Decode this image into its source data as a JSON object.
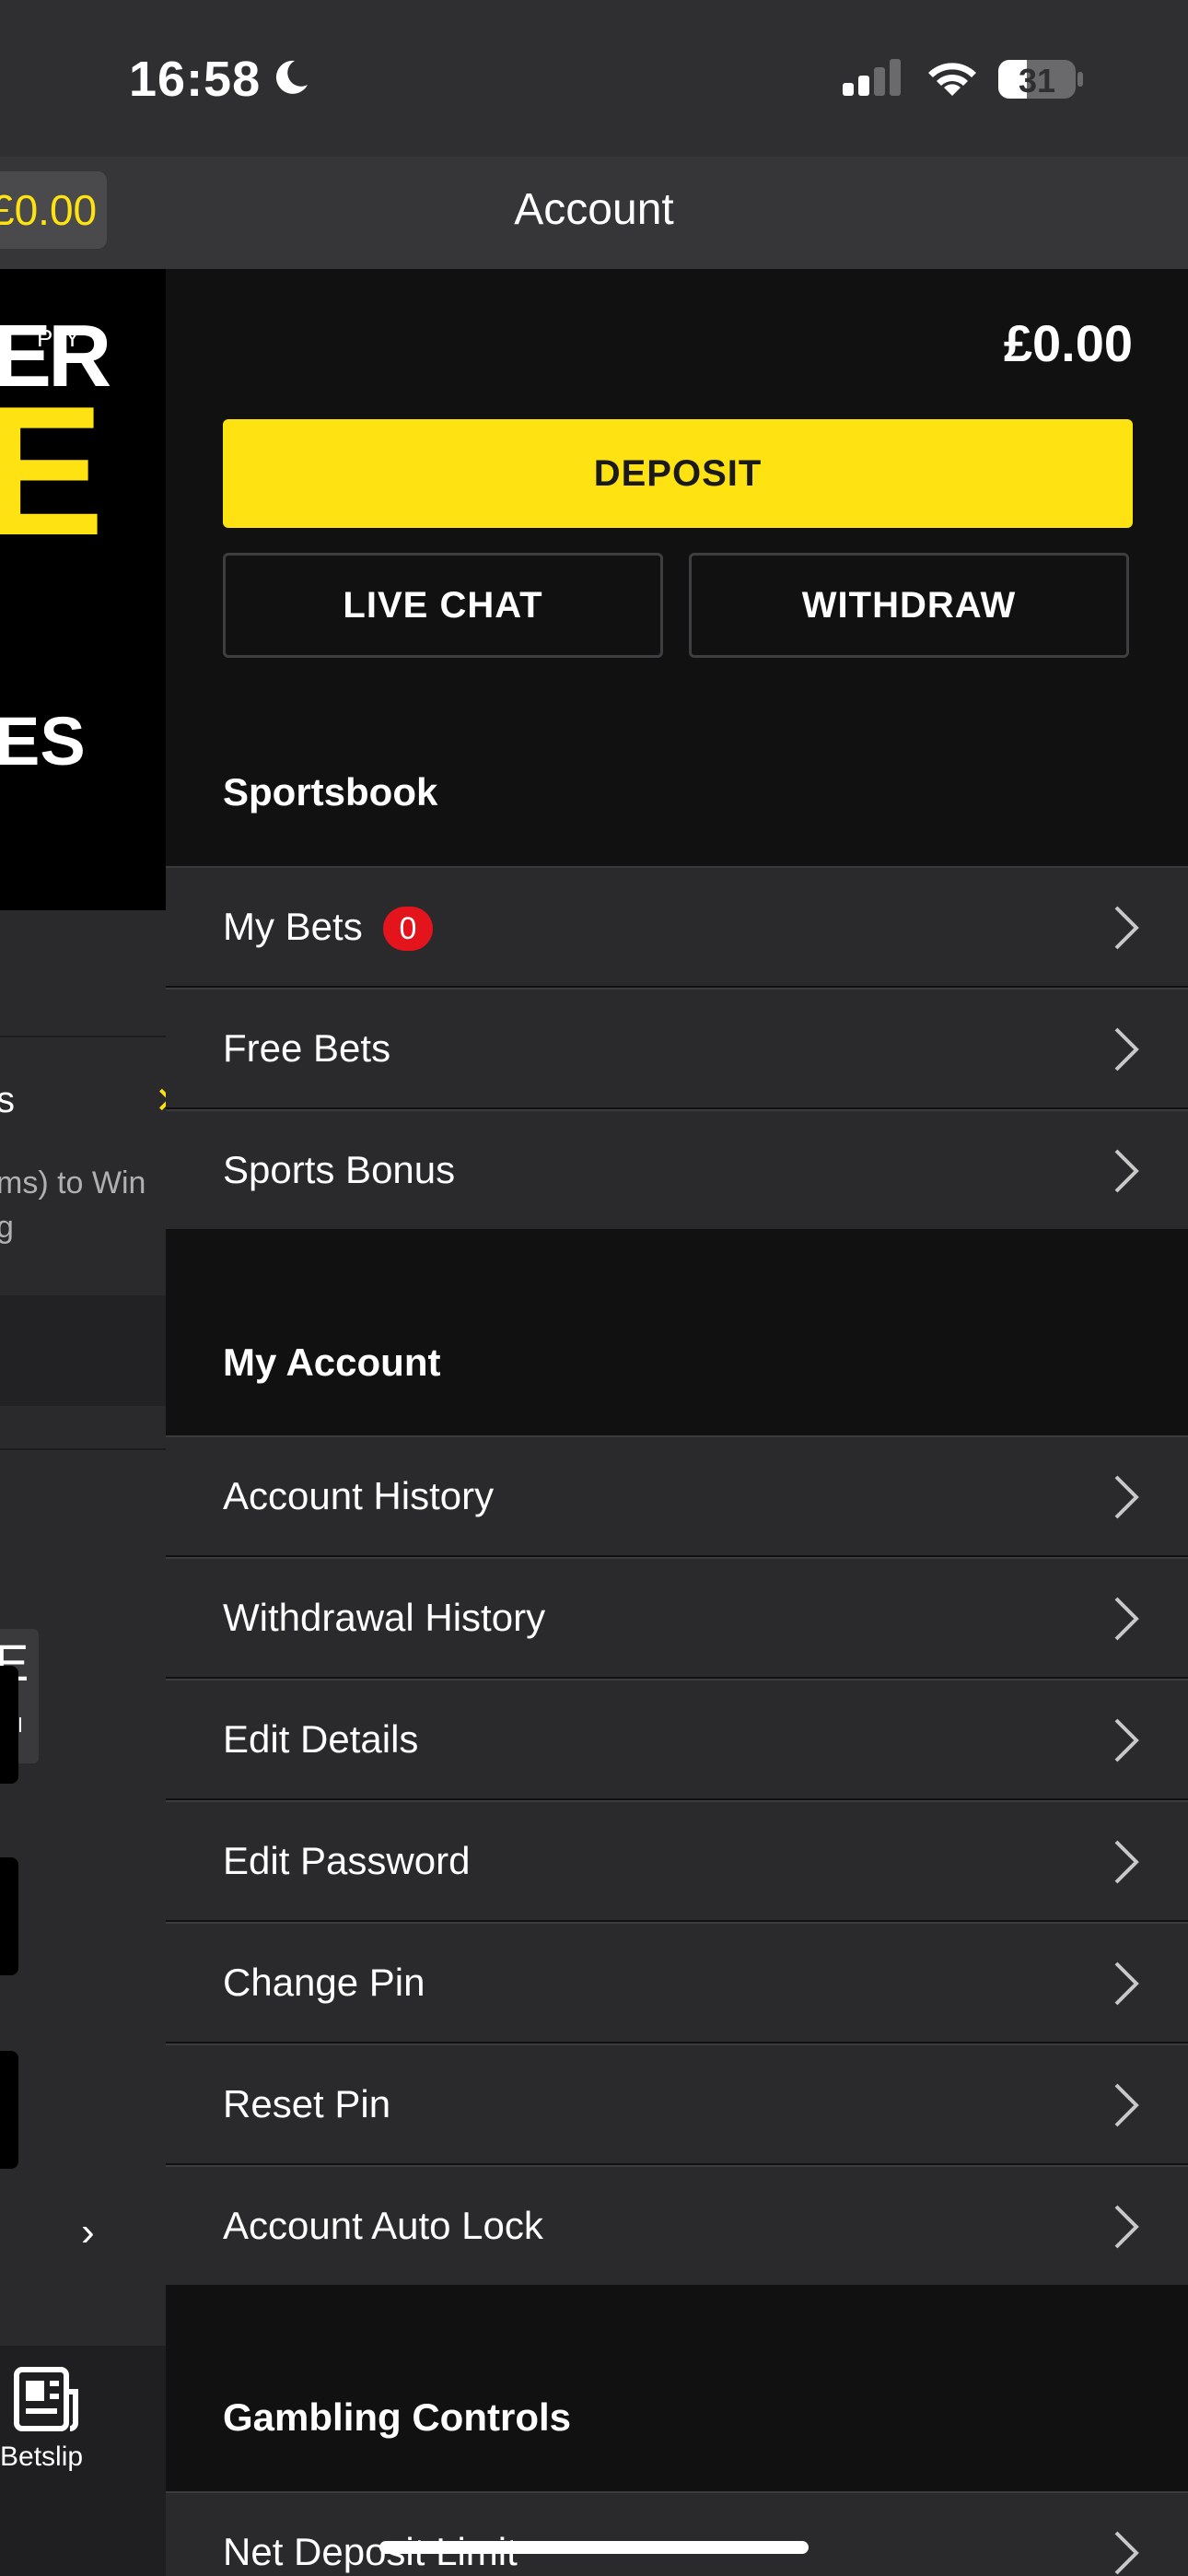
{
  "status_bar": {
    "time": "16:58",
    "battery_level": "31"
  },
  "header": {
    "title": "Account"
  },
  "background_page": {
    "balance": "£0.00",
    "promo_line1": "ER",
    "promo_apply": "PLY",
    "promo_big": "E",
    "promo_line3": "ES",
    "list_title_fragment": "s",
    "list_desc_line1": "ms) to Win",
    "list_desc_line2": "g",
    "card_letter": "E",
    "card_all": "All",
    "betslip_label": "Betslip"
  },
  "account": {
    "balance": "£0.00",
    "deposit_label": "DEPOSIT",
    "live_chat_label": "LIVE CHAT",
    "withdraw_label": "WITHDRAW"
  },
  "sections": {
    "sportsbook": {
      "title": "Sportsbook",
      "items": [
        {
          "label": "My Bets",
          "badge": "0"
        },
        {
          "label": "Free Bets"
        },
        {
          "label": "Sports Bonus"
        }
      ]
    },
    "my_account": {
      "title": "My Account",
      "items": [
        {
          "label": "Account History"
        },
        {
          "label": "Withdrawal History"
        },
        {
          "label": "Edit Details"
        },
        {
          "label": "Edit Password"
        },
        {
          "label": "Change Pin"
        },
        {
          "label": "Reset Pin"
        },
        {
          "label": "Account Auto Lock"
        }
      ]
    },
    "gambling_controls": {
      "title": "Gambling Controls",
      "items": [
        {
          "label": "Net Deposit Limit"
        }
      ]
    }
  },
  "colors": {
    "accent_yellow": "#ffe212",
    "badge_red": "#e3141b",
    "panel_bg": "#111112",
    "row_bg": "#2a2a2c"
  },
  "icons": [
    "moon-icon",
    "cellular-signal-icon",
    "wifi-icon",
    "battery-icon",
    "chevron-right-icon",
    "betslip-icon"
  ]
}
